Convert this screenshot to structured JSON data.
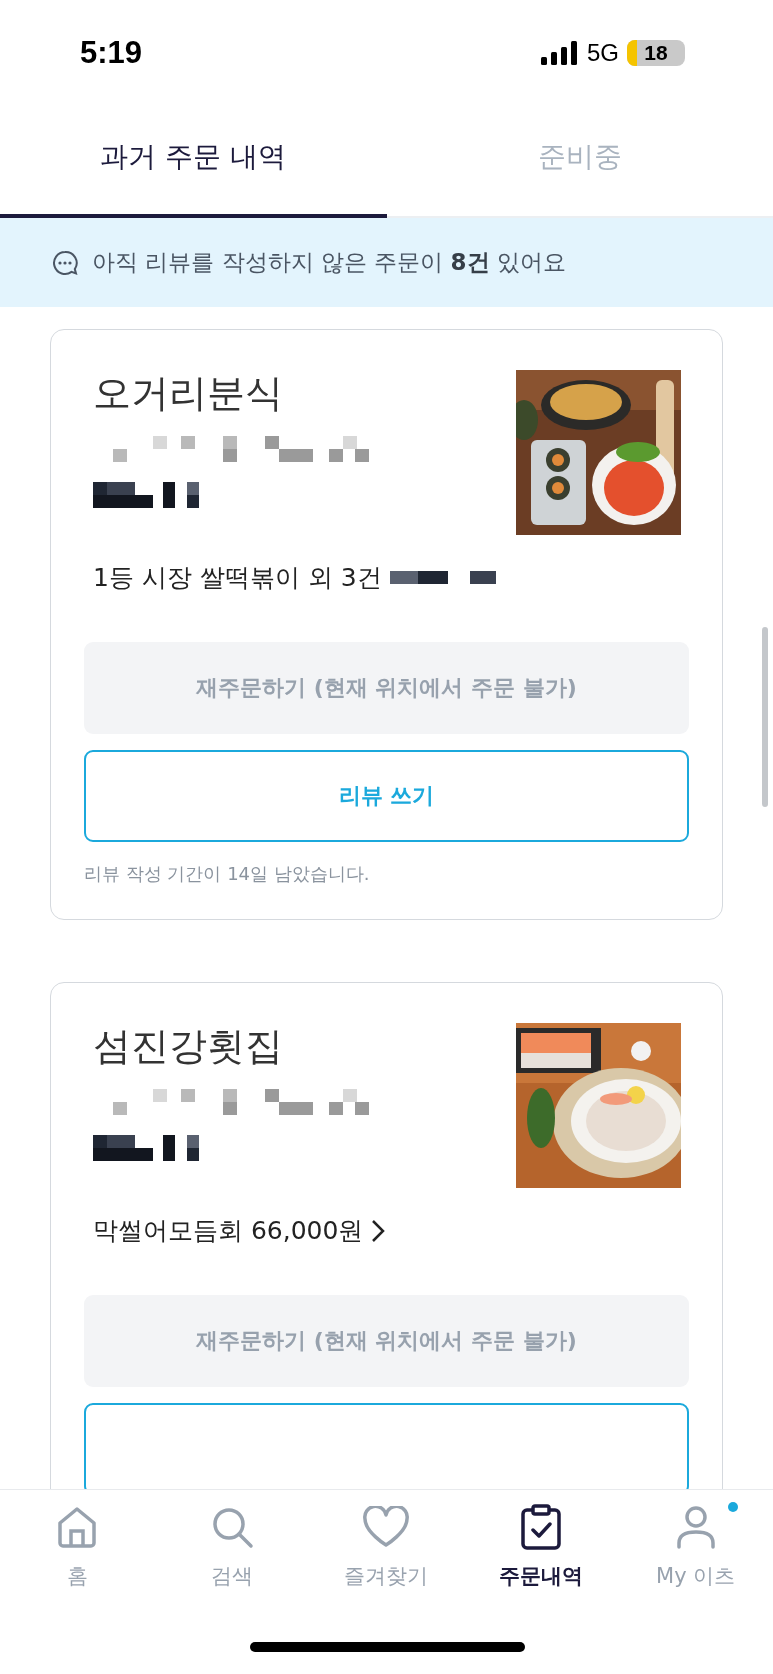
{
  "status_bar": {
    "time": "5:19",
    "network": "5G",
    "battery": "18"
  },
  "tabs": [
    {
      "label": "과거 주문 내역",
      "selected": true
    },
    {
      "label": "준비중",
      "selected": false
    }
  ],
  "banner": {
    "text": "아직 리뷰를 작성하지 않은 주문이 **8건** 있어요"
  },
  "orders": [
    {
      "store": "오거리분식",
      "summary": "1등 시장 쌀떡볶이 외 3건",
      "chevron": false,
      "buttons": [
        {
          "kind": "reorder",
          "label": "재주문하기 (현재 위치에서 주문 불가)"
        },
        {
          "kind": "review",
          "label": "리뷰 쓰기"
        }
      ],
      "note": "리뷰 작성 기간이 14일 남았습니다."
    },
    {
      "store": "섬진강횟집",
      "summary": "막썰어모듬회 66,000원",
      "chevron": true,
      "buttons": [
        {
          "kind": "reorder",
          "label": "재주문하기 (현재 위치에서 주문 불가)"
        },
        {
          "kind": "review"
        }
      ]
    }
  ],
  "nav": [
    {
      "label": "홈",
      "selected": false,
      "badge": false
    },
    {
      "label": "검색",
      "selected": false,
      "badge": false
    },
    {
      "label": "즐겨찾기",
      "selected": false,
      "badge": false
    },
    {
      "label": "주문내역",
      "selected": true,
      "badge": false
    },
    {
      "label": "My 이츠",
      "selected": false,
      "badge": true
    }
  ]
}
